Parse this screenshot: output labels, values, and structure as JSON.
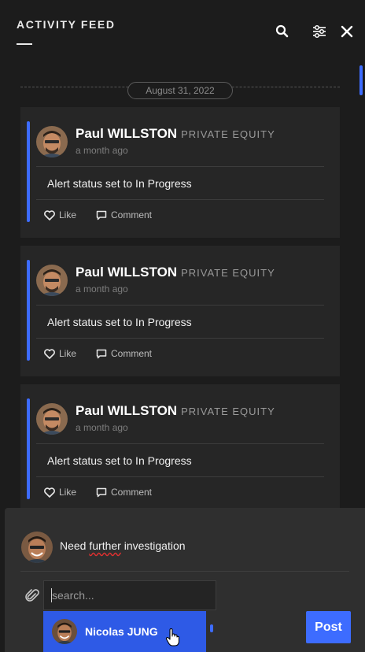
{
  "header": {
    "title": "ACTIVITY FEED",
    "icons": [
      "search-icon",
      "filter-sliders-icon",
      "close-icon"
    ]
  },
  "feed": {
    "date_label": "August 31, 2022",
    "posts": [
      {
        "author": "Paul WILLSTON",
        "department": "PRIVATE EQUITY",
        "time": "a month ago",
        "message": "Alert status set to In Progress",
        "like_label": "Like",
        "comment_label": "Comment"
      },
      {
        "author": "Paul WILLSTON",
        "department": "PRIVATE EQUITY",
        "time": "a month ago",
        "message": "Alert status set to In Progress",
        "like_label": "Like",
        "comment_label": "Comment"
      },
      {
        "author": "Paul WILLSTON",
        "department": "PRIVATE EQUITY",
        "time": "a month ago",
        "message": "Alert status set to In Progress",
        "like_label": "Like",
        "comment_label": "Comment"
      }
    ]
  },
  "composer": {
    "text_part1": "Need ",
    "text_misspelled": "further",
    "text_part2": " investigation",
    "search_placeholder": "search...",
    "suggestion_name": "Nicolas JUNG",
    "post_label": "Post"
  },
  "colors": {
    "accent": "#3d6cff",
    "background": "#1c1c1c",
    "card": "#262626",
    "composer": "#2f2f2f",
    "suggestion": "#2e5ae6"
  }
}
